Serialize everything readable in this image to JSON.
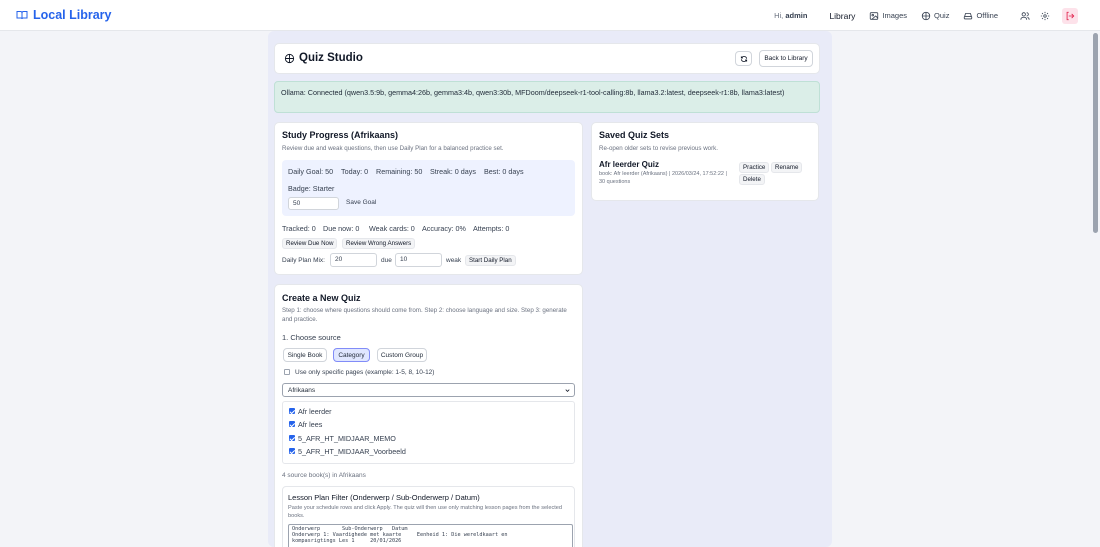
{
  "app": {
    "title": "Local Library"
  },
  "nav": {
    "greeting": "Hi,",
    "user": "admin",
    "library": "Library",
    "images": "Images",
    "quiz": "Quiz",
    "offline": "Offline"
  },
  "header": {
    "title": "Quiz Studio",
    "back_label": "Back to Library"
  },
  "status": {
    "text": "Ollama: Connected (qwen3.5:9b, gemma4:26b, gemma3:4b, qwen3:30b, MFDoom/deepseek-r1-tool-calling:8b, llama3.2:latest, deepseek-r1:8b, llama3:latest)"
  },
  "progress": {
    "title": "Study Progress (Afrikaans)",
    "subtitle": "Review due and weak questions, then use Daily Plan for a balanced practice set.",
    "daily_goal": "Daily Goal: 50",
    "today": "Today: 0",
    "remaining": "Remaining: 50",
    "streak": "Streak: 0 days",
    "best": "Best: 0 days",
    "badge": "Badge: Starter",
    "goal_value": "50",
    "save_goal": "Save Goal",
    "tracked": "Tracked: 0",
    "due_now": "Due now: 0",
    "weak_cards": "Weak cards: 0",
    "accuracy": "Accuracy: 0%",
    "attempts": "Attempts: 0",
    "review_due": "Review Due Now",
    "review_wrong": "Review Wrong Answers",
    "plan_mix_label": "Daily Plan Mix:",
    "plan_due_value": "20",
    "due_label": "due",
    "plan_weak_value": "10",
    "weak_label": "weak",
    "start_plan": "Start Daily Plan"
  },
  "saved": {
    "title": "Saved Quiz Sets",
    "subtitle": "Re-open older sets to revise previous work.",
    "items": [
      {
        "name": "Afr leerder Quiz",
        "meta": "book: Afr leerder (Afrikaans) | 2026/03/24, 17:52:22 |",
        "count": "30 questions",
        "practice": "Practice",
        "rename": "Rename",
        "delete": "Delete"
      }
    ]
  },
  "create": {
    "title": "Create a New Quiz",
    "subtitle": "Step 1: choose where questions should come from. Step 2: choose language and size. Step 3: generate and practice.",
    "step1": "1. Choose source",
    "source_tabs": [
      "Single Book",
      "Category",
      "Custom Group"
    ],
    "specific_pages": "Use only specific pages (example: 1-5, 8, 10-12)",
    "category_value": "Afrikaans",
    "books": [
      "Afr leerder",
      "Afr lees",
      "5_AFR_HT_MIDJAAR_MEMO",
      "5_AFR_HT_MIDJAAR_Voorbeeld"
    ],
    "book_count": "4 source book(s) in Afrikaans",
    "lesson_title": "Lesson Plan Filter (Onderwerp / Sub-Onderwerp / Datum)",
    "lesson_subtitle": "Paste your schedule rows and click Apply. The quiz will then use only matching lesson pages from the selected books.",
    "lesson_text": "Onderwerp       Sub-Onderwerp   Datum\nOnderwerp 1: Vaardighede met kaarte     Eenheid 1: Die wereldkaart en\nkompasrigtings Les 1     20/01/2026"
  },
  "colors": {
    "accent": "#2563eb",
    "status_bg": "#dbeee8",
    "goal_bg": "#eef2ff",
    "logout_bg": "#fde2ea"
  }
}
